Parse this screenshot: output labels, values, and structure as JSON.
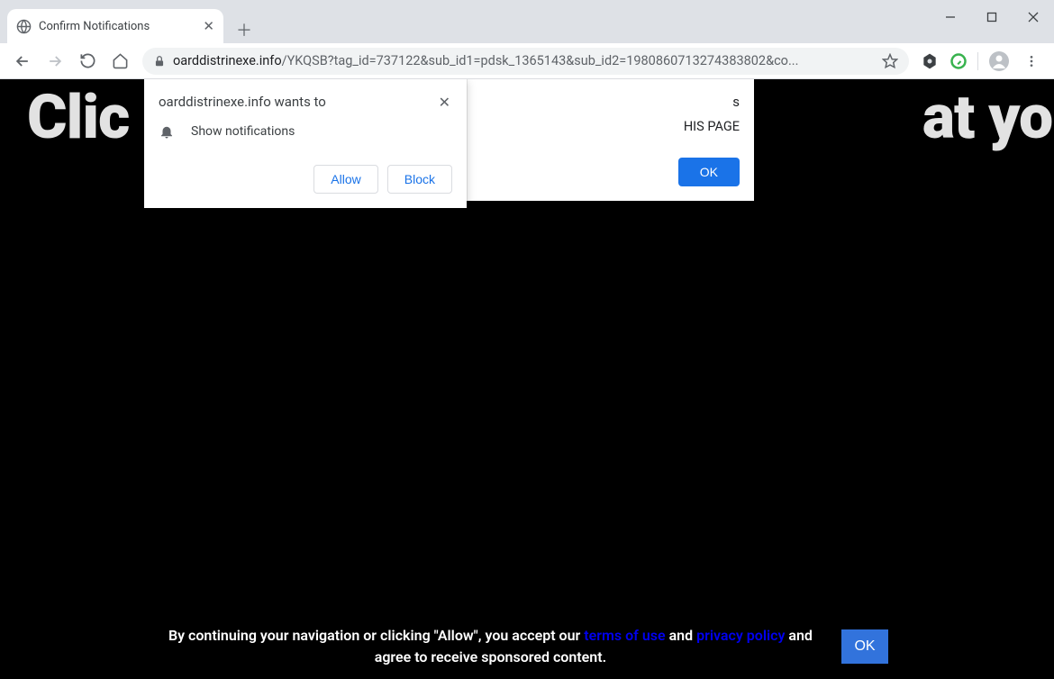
{
  "window": {
    "tab_title": "Confirm Notifications"
  },
  "url": {
    "domain": "oarddistrinexe.info",
    "path": "/YKQSB?tag_id=737122&sub_id1=pdsk_1365143&sub_id2=1980860713274383802&co..."
  },
  "page": {
    "big_text_left": "Clic",
    "big_text_right": "at you are"
  },
  "permission": {
    "title": "oarddistrinexe.info wants to",
    "message": "Show notifications",
    "allow_label": "Allow",
    "block_label": "Block"
  },
  "page_dialog": {
    "title_visible": "s",
    "body_visible": "HIS PAGE",
    "ok_label": "OK"
  },
  "footer": {
    "text_before": "By continuing your navigation or clicking \"Allow\", you accept our ",
    "terms_link": "terms of use",
    "and_text": " and ",
    "privacy_link": "privacy policy",
    "text_after": " and agree to receive sponsored content.",
    "ok_label": "OK"
  }
}
